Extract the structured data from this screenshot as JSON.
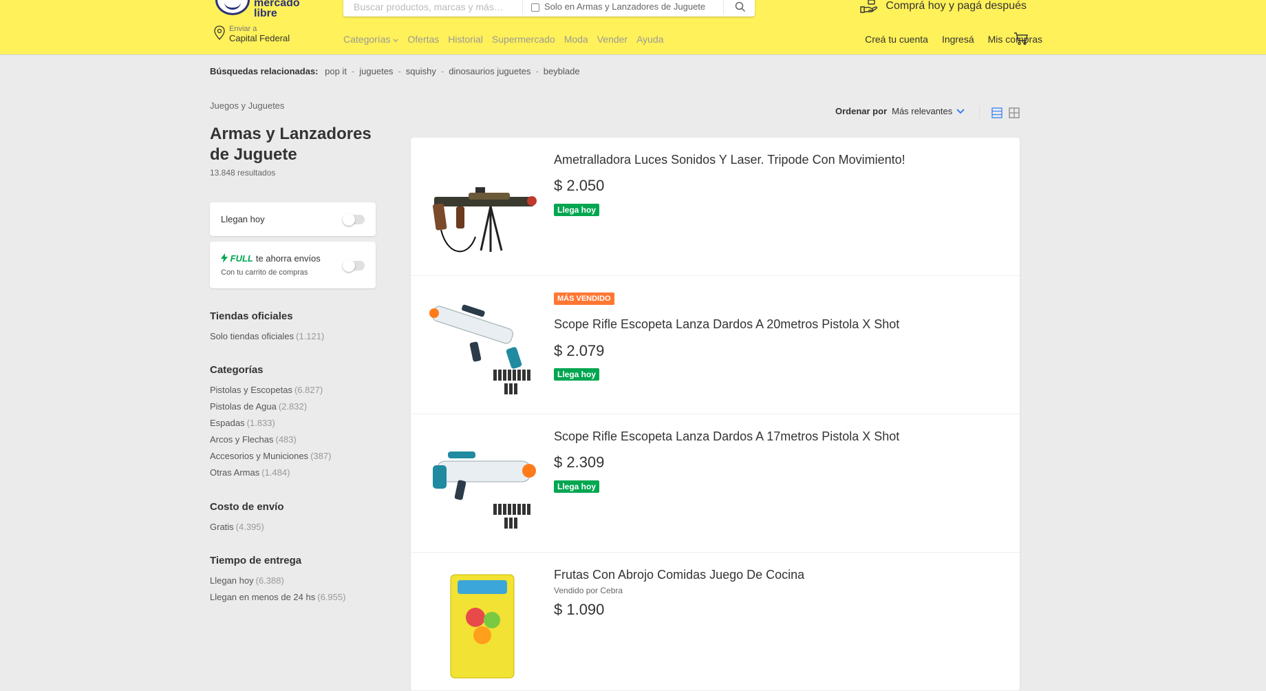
{
  "header": {
    "logo_text": "mercado libre",
    "search": {
      "placeholder": "Buscar productos, marcas y más…",
      "scope_label": "Solo en Armas y Lanzadores de Juguete"
    },
    "promo_text": "Comprá hoy y pagá después",
    "location": {
      "label": "Enviar a",
      "city": "Capital Federal"
    },
    "nav": [
      "Categorías",
      "Ofertas",
      "Historial",
      "Supermercado",
      "Moda",
      "Vender",
      "Ayuda"
    ],
    "user_nav": [
      "Creá tu cuenta",
      "Ingresá",
      "Mis compras"
    ]
  },
  "related": {
    "label": "Búsquedas relacionadas:",
    "items": [
      "pop it",
      "juguetes",
      "squishy",
      "dinosaurios juguetes",
      "beyblade"
    ]
  },
  "breadcrumb": "Juegos y Juguetes",
  "title": "Armas y Lanzadores de Juguete",
  "results": "13.848 resultados",
  "filters": {
    "arrive_today": "Llegan hoy",
    "full_brand": "FULL",
    "full_text": "te ahorra envíos",
    "full_sub": "Con tu carrito de compras",
    "official_title": "Tiendas oficiales",
    "official_item": {
      "label": "Solo tiendas oficiales",
      "count": "(1.121)"
    },
    "categories_title": "Categorías",
    "categories": [
      {
        "label": "Pistolas y Escopetas",
        "count": "(6.827)"
      },
      {
        "label": "Pistolas de Agua",
        "count": "(2.832)"
      },
      {
        "label": "Espadas",
        "count": "(1.833)"
      },
      {
        "label": "Arcos y Flechas",
        "count": "(483)"
      },
      {
        "label": "Accesorios y Municiones",
        "count": "(387)"
      },
      {
        "label": "Otras Armas",
        "count": "(1.484)"
      }
    ],
    "shipping_title": "Costo de envío",
    "shipping_item": {
      "label": "Gratis",
      "count": "(4.395)"
    },
    "delivery_title": "Tiempo de entrega",
    "delivery_items": [
      {
        "label": "Llegan hoy",
        "count": "(6.388)"
      },
      {
        "label": "Llegan en menos de 24 hs",
        "count": "(6.955)"
      }
    ]
  },
  "sort": {
    "label": "Ordenar por",
    "value": "Más relevantes"
  },
  "products": [
    {
      "title": "Ametralladora Luces Sonidos Y Laser. Tripode Con Movimiento!",
      "price": "$ 2.050",
      "arrives": "Llega hoy"
    },
    {
      "badge": "MÁS VENDIDO",
      "title": "Scope Rifle Escopeta Lanza Dardos A 20metros Pistola X Shot",
      "price": "$ 2.079",
      "arrives": "Llega hoy"
    },
    {
      "title": "Scope Rifle Escopeta Lanza Dardos A 17metros Pistola X Shot",
      "price": "$ 2.309",
      "arrives": "Llega hoy"
    },
    {
      "title": "Frutas Con Abrojo Comidas Juego De Cocina",
      "seller": "Vendido por Cebra",
      "price": "$ 1.090"
    }
  ],
  "colors": {
    "header_bg": "#fff159",
    "accent": "#3483fa",
    "green": "#00a650",
    "orange": "#ff7733"
  }
}
